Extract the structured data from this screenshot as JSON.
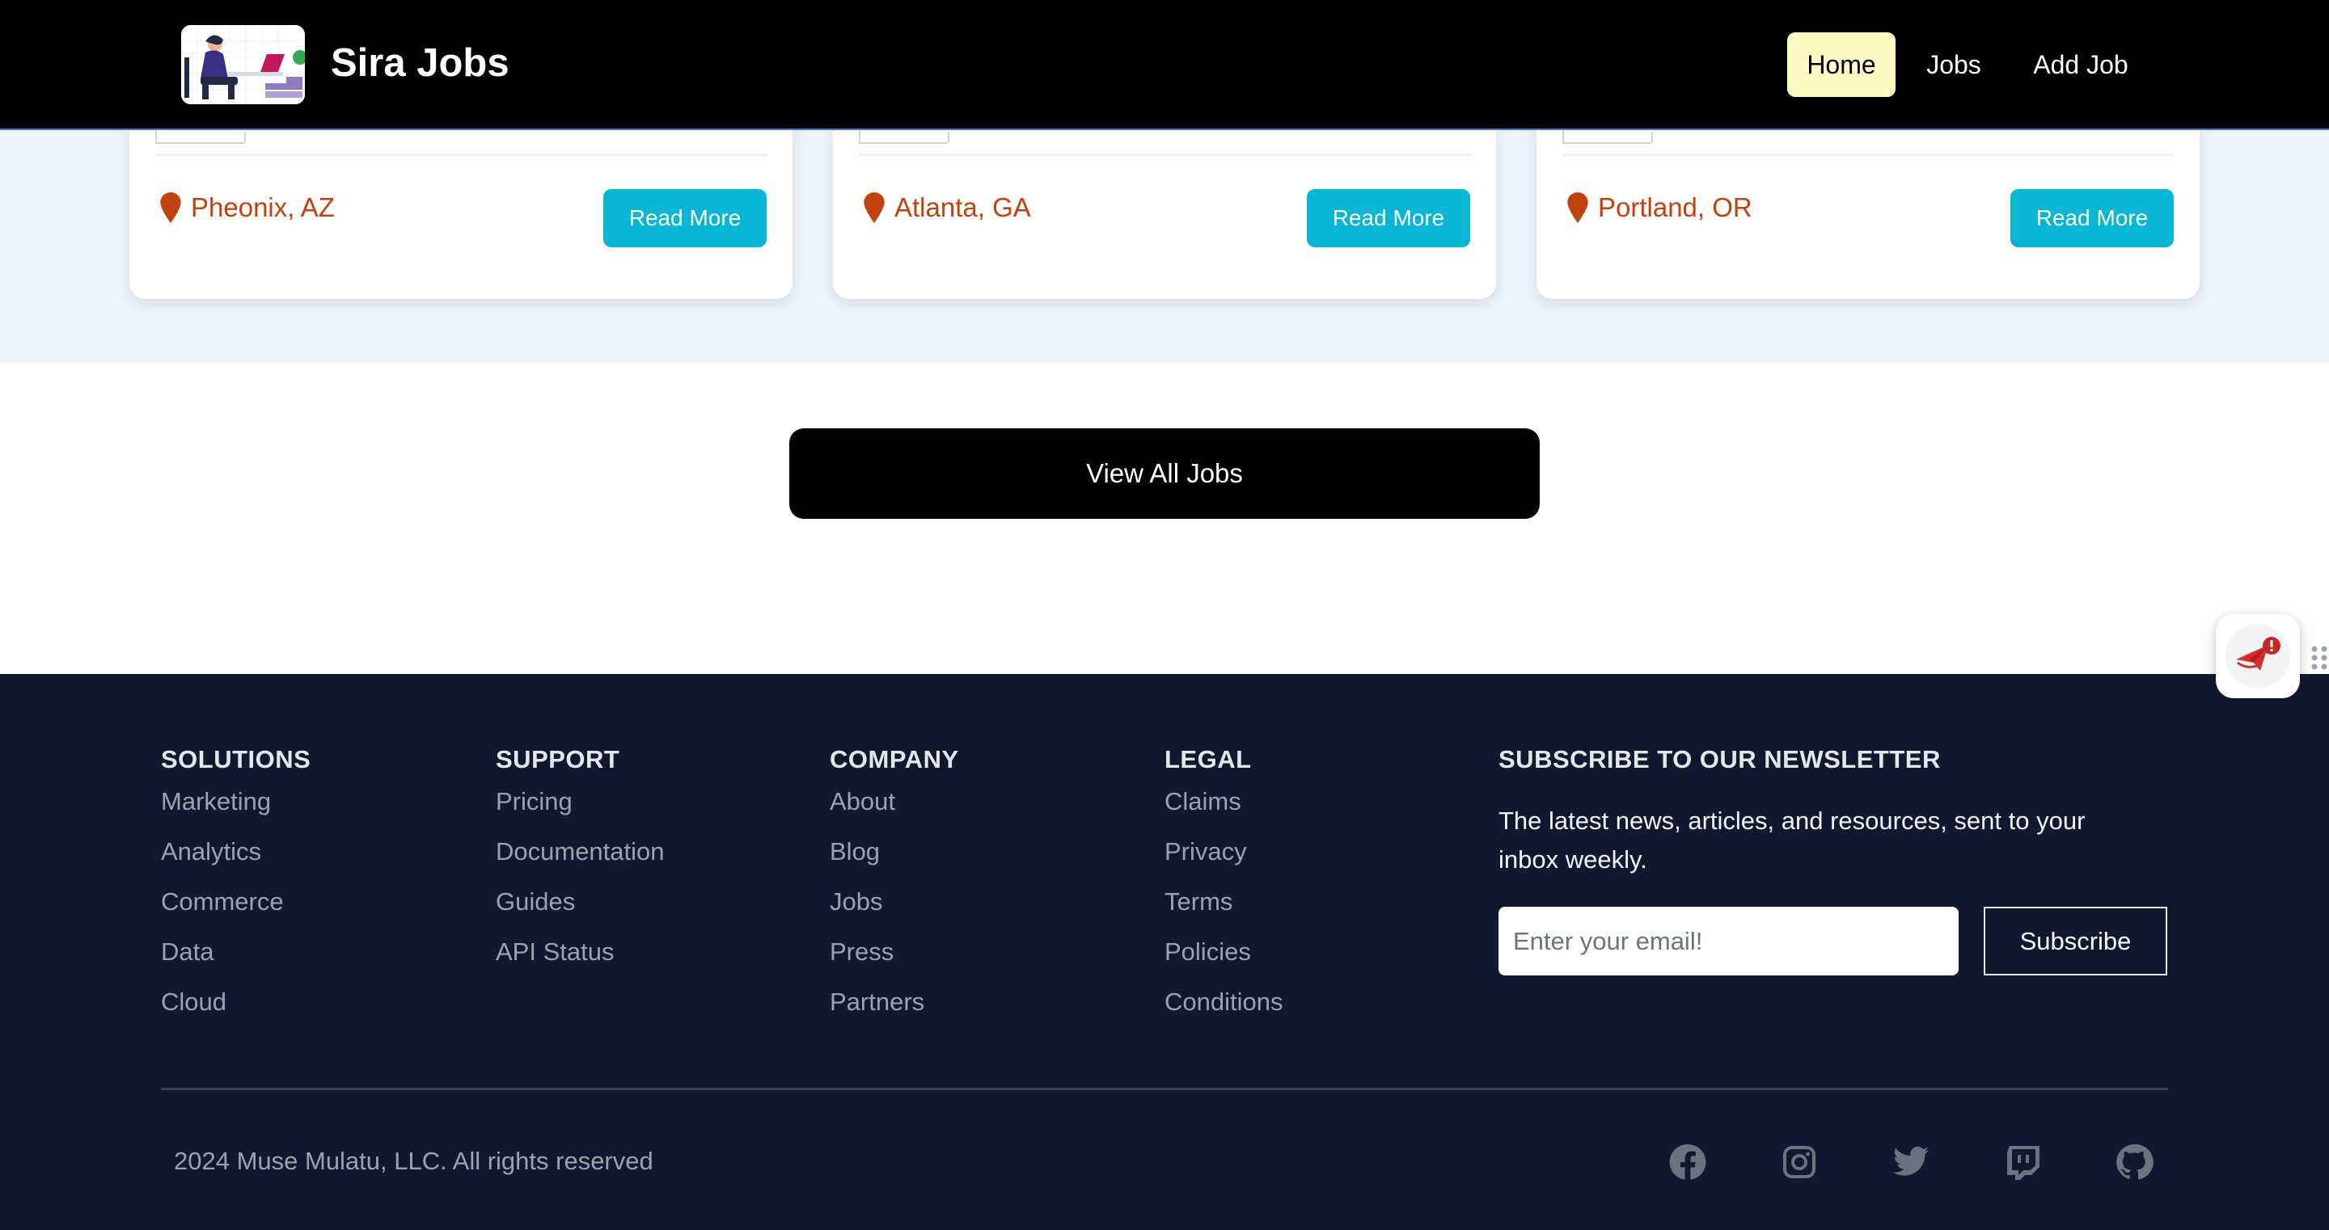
{
  "header": {
    "brand": "Sira Jobs",
    "nav": {
      "home": "Home",
      "jobs": "Jobs",
      "add_job": "Add Job"
    }
  },
  "job_cards": [
    {
      "location": "Pheonix, AZ",
      "read_more": "Read More"
    },
    {
      "location": "Atlanta, GA",
      "read_more": "Read More"
    },
    {
      "location": "Portland, OR",
      "read_more": "Read More"
    }
  ],
  "view_all": "View All Jobs",
  "footer": {
    "columns": [
      {
        "title": "SOLUTIONS",
        "links": [
          "Marketing",
          "Analytics",
          "Commerce",
          "Data",
          "Cloud"
        ]
      },
      {
        "title": "SUPPORT",
        "links": [
          "Pricing",
          "Documentation",
          "Guides",
          "API Status"
        ]
      },
      {
        "title": "COMPANY",
        "links": [
          "About",
          "Blog",
          "Jobs",
          "Press",
          "Partners"
        ]
      },
      {
        "title": "LEGAL",
        "links": [
          "Claims",
          "Privacy",
          "Terms",
          "Policies",
          "Conditions"
        ]
      }
    ],
    "newsletter": {
      "title": "SUBSCRIBE TO OUR NEWSLETTER",
      "description": "The latest news, articles, and resources, sent to your inbox weekly.",
      "email_placeholder": "Enter your email!",
      "button": "Subscribe"
    },
    "copyright": "2024 Muse Mulatu, LLC. All rights reserved",
    "social_icons": [
      "facebook-icon",
      "instagram-icon",
      "twitter-icon",
      "twitch-icon",
      "github-icon"
    ]
  },
  "colors": {
    "header_bg": "#000000",
    "active_nav_bg": "#fef9c3",
    "read_more_bg": "#06b6d4",
    "location_text": "#c2410c",
    "footer_bg": "#121830",
    "band_bg": "#eef4fe"
  }
}
